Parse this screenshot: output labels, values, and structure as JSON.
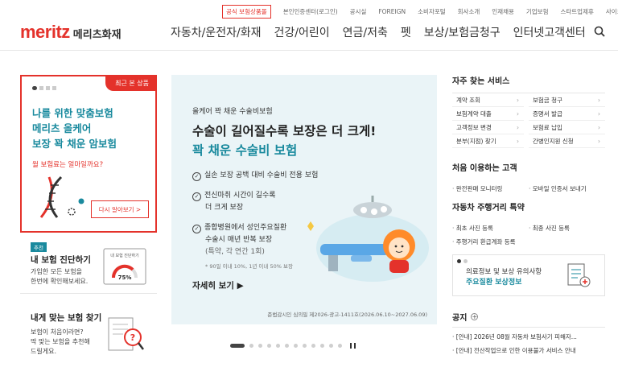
{
  "utility_nav": {
    "promo": "공식 보험상품몰",
    "links": [
      "본인인증센터(로그인)",
      "공시실",
      "FOREIGN",
      "소비자포털",
      "회사소개",
      "인재채용",
      "기업보험",
      "스타트업제휴",
      "사이트맵"
    ]
  },
  "logo": {
    "en": "meritz",
    "ko": "메리츠화재"
  },
  "gnb": [
    "자동차/운전자/화재",
    "건강/어린이",
    "연금/저축",
    "펫",
    "보상/보험금청구",
    "인터넷고객센터"
  ],
  "left": {
    "recent": {
      "badge": "최근 본 상품",
      "title": "나를 위한 맞춤보험\n메리츠 올케어\n보장 꽉 채운 암보험",
      "sub": "월 보험료는 얼마일까요?",
      "button": "다시 알아보기 >"
    },
    "diagnosis": {
      "tag": "추천",
      "title": "내 보험 진단하기",
      "desc": "가입한 모든 보험을\n한번에 확인해보세요.",
      "ill_label": "내 보험 진단하기",
      "ill_pct": "75%"
    },
    "find": {
      "title": "내게 맞는 보험 찾기",
      "desc": "보험이 처음이라면?\n딱 맞는 보험을 추천해\n드릴게요."
    }
  },
  "banner": {
    "eyebrow": "올케어 꽉 채운 수술비보험",
    "headline": "수술이 길어질수록 보장은 더 크게!",
    "headline2": "꽉 채운 수술비 보험",
    "features": [
      {
        "line1": "실손 보장 공백 대비 수술비 전용 보험",
        "line2": ""
      },
      {
        "line1": "전신마취 시간이 길수록",
        "line2": "더 크게 보장"
      },
      {
        "line1": "종합병원에서 성인주요질환",
        "line2": "수술시 매년 반복 보장"
      }
    ],
    "feature3_extra": "(특약, 각 연간 1회)",
    "note": "* 90일 이내 10%, 1년 이내 50% 보장",
    "more": "자세히 보기 ▶",
    "legal": "준법감시인 심의필 제2026-광고-1411호(2026.06.10~2027.06.09)"
  },
  "right": {
    "services_title": "자주 찾는 서비스",
    "services": [
      "계약 조회",
      "보험금 청구",
      "보험계약 대출",
      "증명서 발급",
      "고객정보 변경",
      "보험료 납입",
      "분부(지점) 찾기",
      "간병인지원 신청"
    ],
    "firsttime_title": "처음 이용하는 고객",
    "firsttime": [
      "완전판매 모니터링",
      "모바일 인증서 보내기"
    ],
    "mileage_title": "자동차 주행거리 특약",
    "mileage": [
      "최초 사진 등록",
      "최종 사진 등록",
      "주행거리 환급계좌 등록"
    ],
    "notice_box": {
      "line1": "의료정보 및 보상 유의사항",
      "line2": "주요질환 보상정보"
    },
    "notice": {
      "title": "공지",
      "rows": [
        "[안내] 2026년 08월 자동차 보험사기 피해자...",
        "[안내] 전산작업으로 인한 이용불가 서비스 안내"
      ]
    }
  },
  "colors": {
    "brand": "#e4322b",
    "teal": "#1a8a9e",
    "banner_bg": "#eaf4f7"
  }
}
